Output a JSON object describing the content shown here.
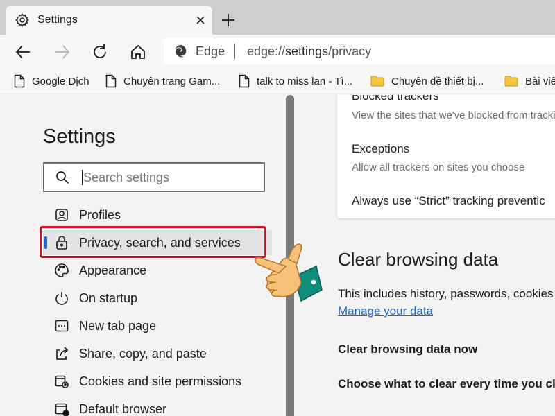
{
  "tab": {
    "title": "Settings",
    "icon": "gear-icon",
    "close_icon": "close-icon"
  },
  "newtab": {
    "icon": "plus-icon"
  },
  "toolbar": {
    "back_icon": "back-arrow-icon",
    "forward_icon": "forward-arrow-icon",
    "refresh_icon": "refresh-icon",
    "home_icon": "home-icon"
  },
  "address": {
    "brand": "Edge",
    "url_prefix": "edge://",
    "url_main": "settings",
    "url_suffix": "/privacy"
  },
  "favorites": [
    {
      "label": "Google Dịch",
      "icon": "page-icon"
    },
    {
      "label": "Chuyên trang Gam...",
      "icon": "page-icon"
    },
    {
      "label": "talk to miss lan - Tì...",
      "icon": "page-icon"
    },
    {
      "label": "Chuyên đề thiết bị...",
      "icon": "folder-icon"
    },
    {
      "label": "Bài viế",
      "icon": "folder-icon"
    }
  ],
  "sidebar": {
    "title": "Settings",
    "search_placeholder": "Search settings",
    "items": [
      {
        "label": "Profiles",
        "icon": "profile-icon"
      },
      {
        "label": "Privacy, search, and services",
        "icon": "lock-icon",
        "active": true
      },
      {
        "label": "Appearance",
        "icon": "palette-icon"
      },
      {
        "label": "On startup",
        "icon": "power-icon"
      },
      {
        "label": "New tab page",
        "icon": "new-tab-page-icon"
      },
      {
        "label": "Share, copy, and paste",
        "icon": "share-icon"
      },
      {
        "label": "Cookies and site permissions",
        "icon": "cookies-icon"
      },
      {
        "label": "Default browser",
        "icon": "default-browser-icon"
      }
    ]
  },
  "main": {
    "card": {
      "blocked_title": "Blocked trackers",
      "blocked_sub": "View the sites that we've blocked from tracki",
      "exceptions_title": "Exceptions",
      "exceptions_sub": "Allow all trackers on sites you choose",
      "strict_title": "Always use “Strict” tracking preventic"
    },
    "section_title": "Clear browsing data",
    "description": "This includes history, passwords, cookies",
    "manage_link": "Manage your data",
    "clear_now": "Clear browsing data now",
    "choose_clear": "Choose what to clear every time you clo"
  },
  "colors": {
    "accent": "#1a63c7",
    "highlight": "#d0101c",
    "hand_skin": "#f6c27a",
    "hand_cuff": "#0f8d7a"
  }
}
